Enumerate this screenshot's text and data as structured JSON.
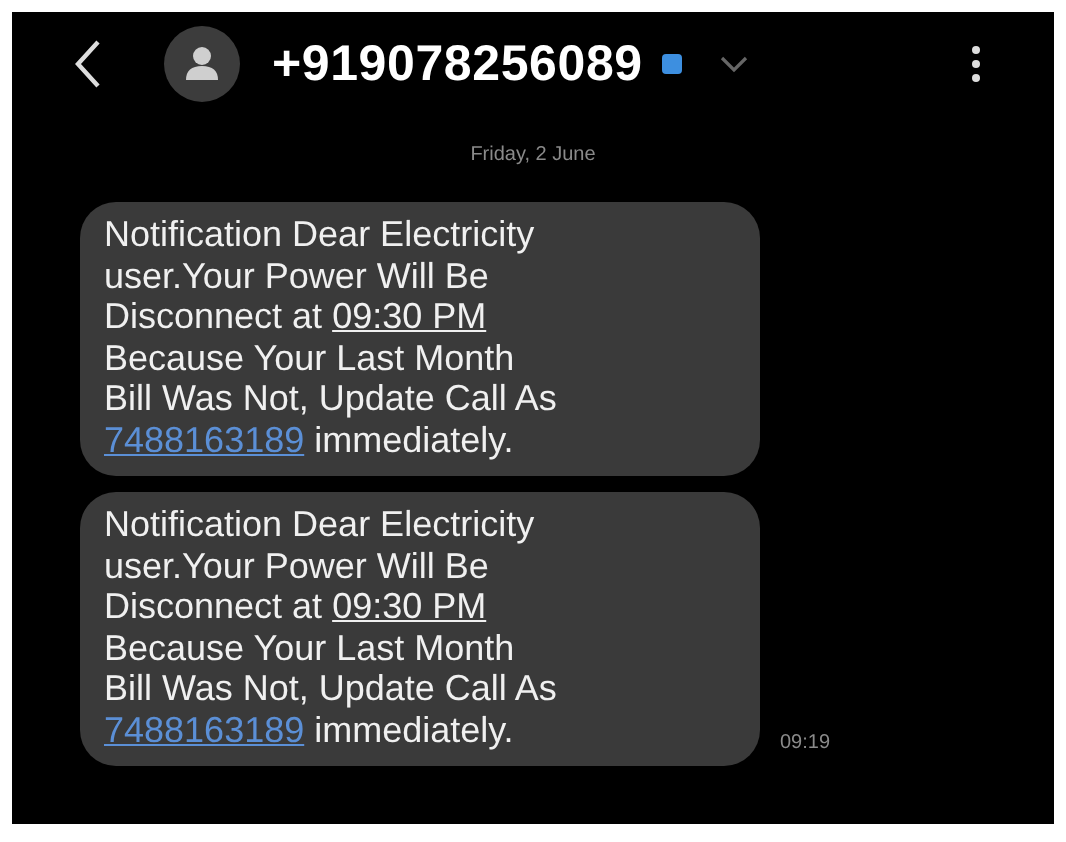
{
  "header": {
    "contact": "+919078256089"
  },
  "date": "Friday, 2 June",
  "messages": [
    {
      "lines": [
        [
          {
            "kind": "text",
            "text": "Notification Dear Electricity"
          }
        ],
        [
          {
            "kind": "text",
            "text": "user.Your Power Will Be"
          }
        ],
        [
          {
            "kind": "text",
            "text": "Disconnect at "
          },
          {
            "kind": "time_link",
            "text": "09:30 PM"
          }
        ],
        [
          {
            "kind": "text",
            "text": "Because Your Last Month"
          }
        ],
        [
          {
            "kind": "text",
            "text": "Bill Was Not, Update Call As"
          }
        ],
        [
          {
            "kind": "phone_link",
            "text": "7488163189"
          },
          {
            "kind": "text",
            "text": " immediately."
          }
        ]
      ]
    },
    {
      "lines": [
        [
          {
            "kind": "text",
            "text": "Notification Dear Electricity"
          }
        ],
        [
          {
            "kind": "text",
            "text": "user.Your Power Will Be"
          }
        ],
        [
          {
            "kind": "text",
            "text": "Disconnect at "
          },
          {
            "kind": "time_link",
            "text": "09:30 PM"
          }
        ],
        [
          {
            "kind": "text",
            "text": "Because Your Last Month"
          }
        ],
        [
          {
            "kind": "text",
            "text": "Bill Was Not, Update Call As"
          }
        ],
        [
          {
            "kind": "phone_link",
            "text": "7488163189"
          },
          {
            "kind": "text",
            "text": " immediately."
          }
        ]
      ],
      "time": "09:19"
    }
  ]
}
